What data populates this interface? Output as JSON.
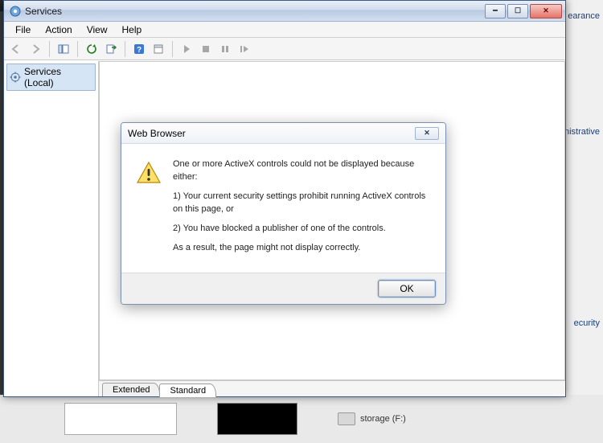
{
  "bg": {
    "right_items": [
      "earance",
      "ministrative T",
      "ecurity"
    ],
    "storage_label": "storage (F:)"
  },
  "services": {
    "title": "Services",
    "menu": {
      "file": "File",
      "action": "Action",
      "view": "View",
      "help": "Help"
    },
    "tree": {
      "root": "Services (Local)"
    },
    "tabs": {
      "extended": "Extended",
      "standard": "Standard"
    }
  },
  "dialog": {
    "title": "Web Browser",
    "line_intro": "One or more ActiveX controls could not be displayed because either:",
    "line_1": "1) Your current security settings prohibit running ActiveX controls on this page, or",
    "line_2": "2) You have blocked a publisher of one of the controls.",
    "line_result": "As a result, the page might not display correctly.",
    "ok": "OK"
  }
}
